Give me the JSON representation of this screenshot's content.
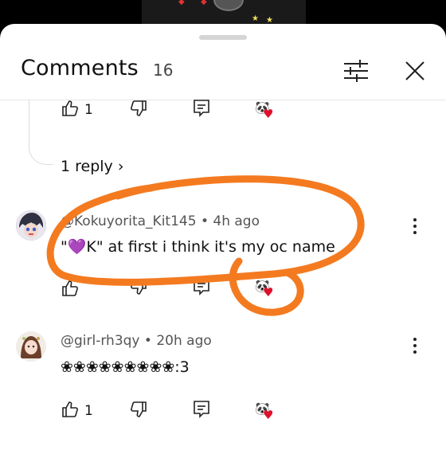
{
  "header": {
    "title": "Comments",
    "count": "16"
  },
  "top_comment_actions": {
    "like_count": "1",
    "replies_label": "1 reply"
  },
  "comments": [
    {
      "author": "@Kokuyorita_Kit145",
      "time": "4h ago",
      "text": "\"💜K\" at first i think it's my oc name"
    },
    {
      "author": "@girl-rh3qy",
      "time": "20h ago",
      "text": "❀❀❀❀❀❀❀❀❀:3",
      "like_count": "1"
    }
  ],
  "colors": {
    "annotation": "#f47a20",
    "creator_heart": "#e0102b"
  },
  "separator": "•"
}
